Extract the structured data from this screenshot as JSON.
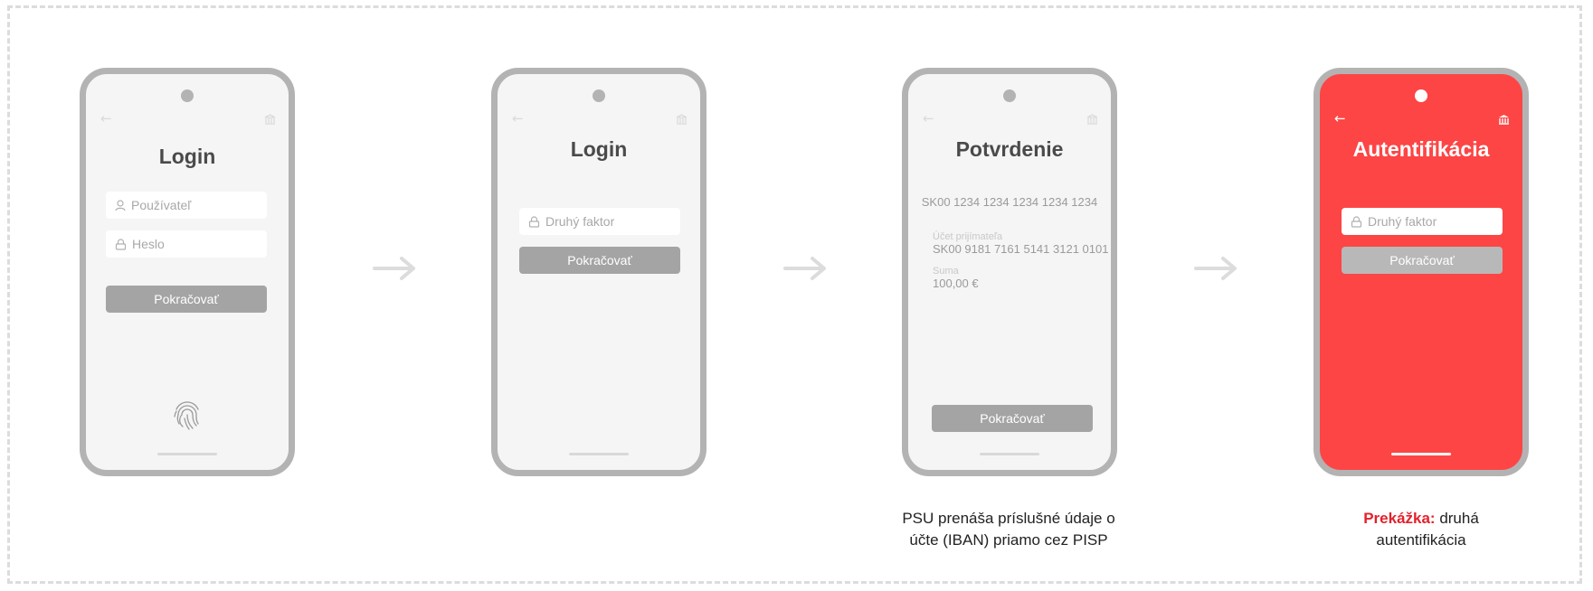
{
  "screens": [
    {
      "title": "Login",
      "fields": [
        {
          "icon": "user-icon",
          "placeholder": "Používateľ"
        },
        {
          "icon": "lock-icon",
          "placeholder": "Heslo"
        }
      ],
      "button": "Pokračovať",
      "extra_icon": "fingerprint-icon"
    },
    {
      "title": "Login",
      "fields": [
        {
          "icon": "lock-icon",
          "placeholder": "Druhý faktor"
        }
      ],
      "button": "Pokračovať"
    },
    {
      "title": "Potvrdenie",
      "iban": "SK00 1234 1234 1234 1234 1234",
      "recipient_label": "Účet prijímateľa",
      "recipient_value": "SK00 9181 7161 5141 3121 0101",
      "amount_label": "Suma",
      "amount_value": "100,00 €",
      "button": "Pokračovať"
    },
    {
      "title": "Autentifikácia",
      "fields": [
        {
          "icon": "lock-icon",
          "placeholder": "Druhý faktor"
        }
      ],
      "button": "Pokračovať",
      "background": "#fd4545"
    }
  ],
  "captions": {
    "screen3": [
      "PSU prenáša príslušné údaje o",
      "účte (IBAN) priamo cez PISP"
    ],
    "screen4": {
      "highlight": "Prekážka:",
      "line1_rest": " druhá",
      "line2": "autentifikácia"
    }
  },
  "colors": {
    "accent": "#fd4545",
    "highlight_text": "#e3212b",
    "frame": "#b3b3b3"
  }
}
